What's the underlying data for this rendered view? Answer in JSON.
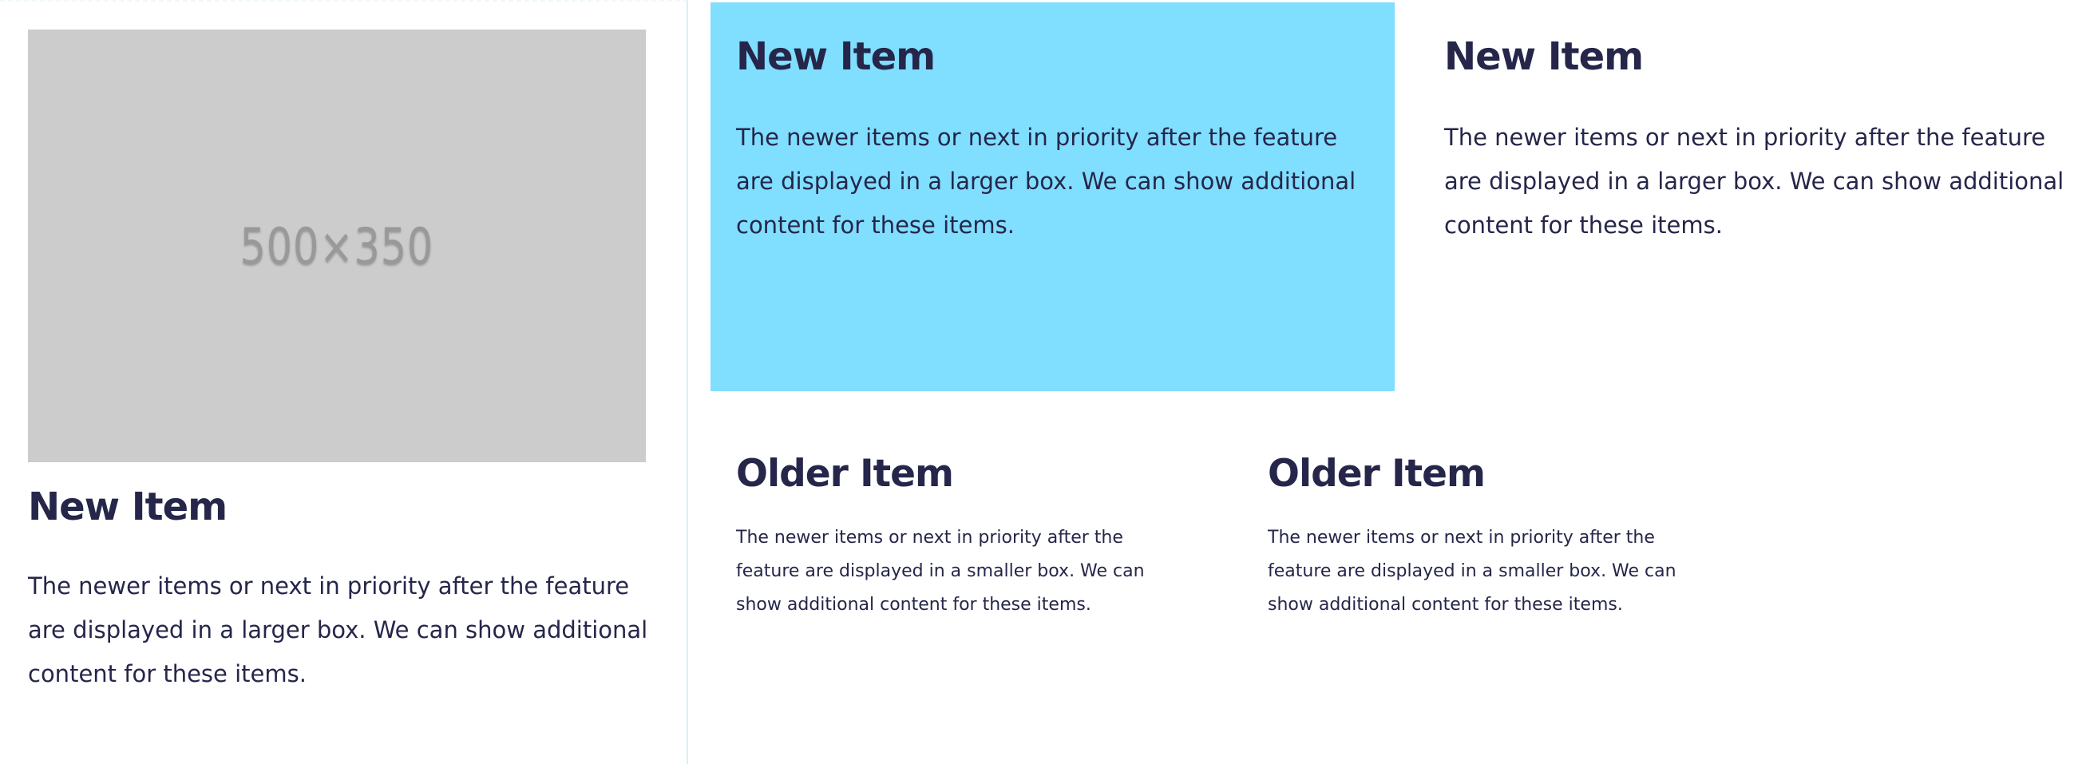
{
  "feature_item": {
    "image_placeholder": "500×350",
    "title": "New Item",
    "description": "The newer items or next in priority after the feature are displayed in a larger box. We can show additional content for these items."
  },
  "new_items": [
    {
      "title": "New Item",
      "description": "The newer items or next in priority after the feature are displayed in a larger box. We can show additional content for these items.",
      "highlight_color": "#80defe"
    },
    {
      "title": "New Item",
      "description": "The newer items or next in priority after the feature are displayed in a larger box. We can show additional content for these items."
    }
  ],
  "older_items": [
    {
      "title": "Older Item",
      "description": "The newer items or next in priority after the feature are displayed in a smaller box. We can show additional content for these items."
    },
    {
      "title": "Older Item",
      "description": "The newer items or next in priority after the feature are displayed in a smaller box. We can show additional content for these items."
    }
  ],
  "colors": {
    "text": "#25264a",
    "highlight": "#80defe",
    "placeholder_bg": "#cccccc",
    "placeholder_text": "#999999",
    "divider": "#d6f0fb"
  }
}
